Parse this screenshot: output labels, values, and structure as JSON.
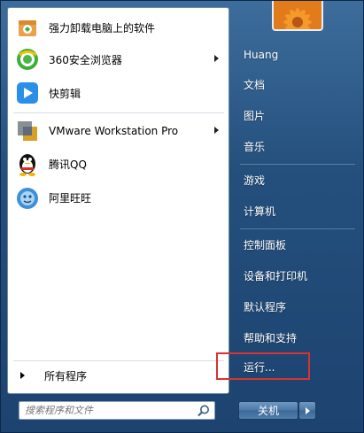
{
  "pinned_programs": [
    {
      "label": "强力卸载电脑上的软件",
      "icon": "uninstaller-icon",
      "has_submenu": false
    },
    {
      "label": "360安全浏览器",
      "icon": "360-browser-icon",
      "has_submenu": true
    },
    {
      "label": "快剪辑",
      "icon": "video-editor-icon",
      "has_submenu": false
    }
  ],
  "recent_programs": [
    {
      "label": "VMware Workstation Pro",
      "icon": "vmware-icon",
      "has_submenu": true
    },
    {
      "label": "腾讯QQ",
      "icon": "qq-penguin-icon",
      "has_submenu": false
    },
    {
      "label": "阿里旺旺",
      "icon": "aliwangwang-icon",
      "has_submenu": false
    }
  ],
  "all_programs_label": "所有程序",
  "search": {
    "placeholder": "搜索程序和文件"
  },
  "right_menu": [
    {
      "label": "Huang"
    },
    {
      "label": "文档"
    },
    {
      "label": "图片"
    },
    {
      "label": "音乐"
    },
    {
      "label": "游戏"
    },
    {
      "label": "计算机"
    },
    {
      "label": "控制面板"
    },
    {
      "label": "设备和打印机"
    },
    {
      "label": "默认程序"
    },
    {
      "label": "帮助和支持"
    },
    {
      "label": "运行..."
    }
  ],
  "shutdown_label": "关机",
  "colors": {
    "highlight": "#d9322f",
    "menu_bg": "#2a5585"
  }
}
